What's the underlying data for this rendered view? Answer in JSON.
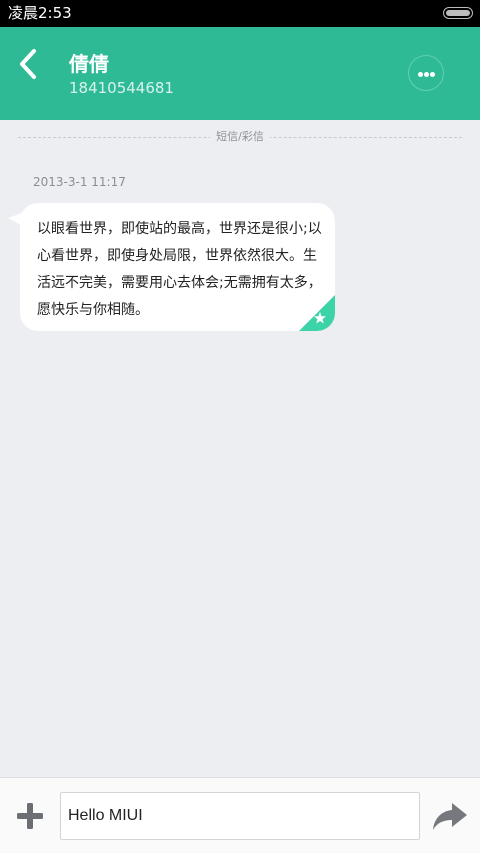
{
  "status_bar": {
    "time": "凌晨2:53"
  },
  "header": {
    "contact_name": "倩倩",
    "contact_number": "18410544681"
  },
  "conversation": {
    "type_label": "短信/彩信",
    "timestamp": "2013-3-1 11:17",
    "messages": [
      {
        "text": "以眼看世界，即使站的最高，世界还是很小;以心看世界，即使身处局限，世界依然很大。生活远不完美，需要用心去体会;无需拥有太多，愿快乐与你相随。",
        "starred": true
      }
    ]
  },
  "input_bar": {
    "value": "Hello MIUI"
  },
  "colors": {
    "accent": "#2fba96",
    "background": "#eceef2",
    "bubble": "#ffffff",
    "star_badge": "#3dd3a8"
  },
  "icons": {
    "back": "chevron-left-icon",
    "more": "more-dots-icon",
    "add": "plus-icon",
    "send": "forward-arrow-icon",
    "star": "star-icon"
  }
}
